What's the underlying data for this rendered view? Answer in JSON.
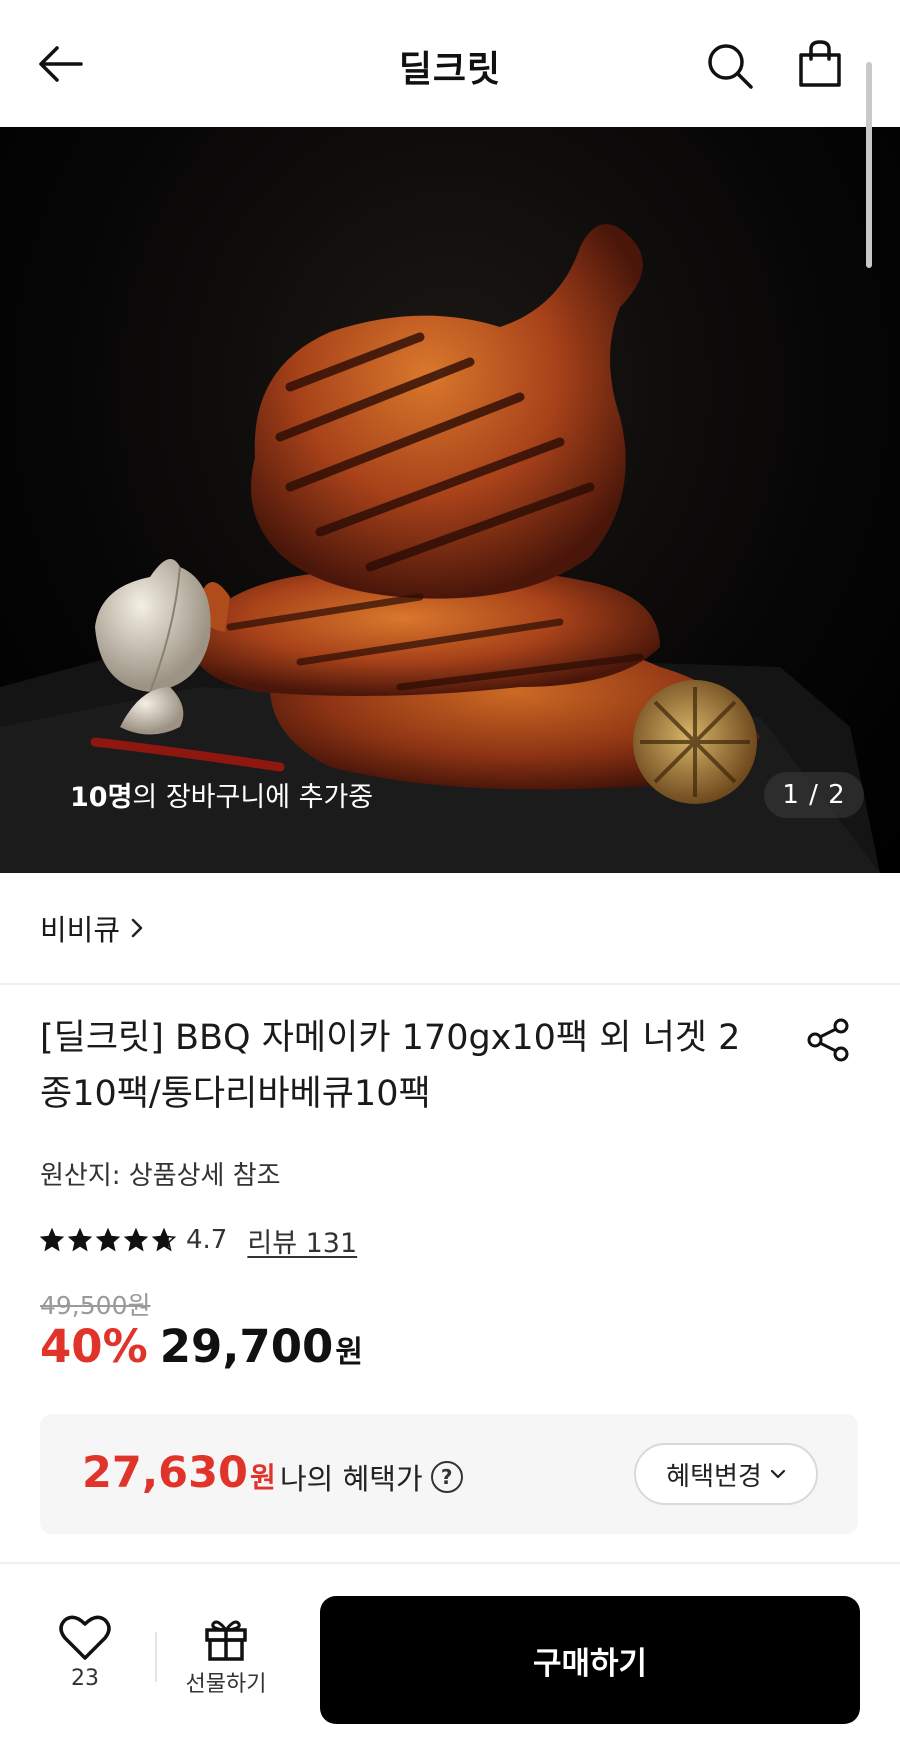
{
  "header": {
    "title": "딜크릿",
    "back_icon": "arrow-left-icon",
    "search_icon": "search-icon",
    "cart_icon": "shopping-bag-icon"
  },
  "hero": {
    "cart_count_bold": "10명",
    "cart_count_rest": "의 장바구니에 추가중",
    "page_indicator": "1 / 2"
  },
  "brand": {
    "name": "비비큐",
    "chevron": "›"
  },
  "product": {
    "title": "[딜크릿] BBQ 자메이카 170gx10팩 외 너겟 2종10팩/통다리바베큐10팩",
    "origin": "원산지: 상품상세 참조",
    "rating": "4.7",
    "rating_stars": 4.7,
    "review_link": "리뷰 131",
    "original_price": "49,500원",
    "discount": "40%",
    "price": "29,700",
    "currency": "원"
  },
  "benefit": {
    "amount": "27,630",
    "currency": "원",
    "label": "나의 혜택가",
    "help": "?",
    "change_button": "혜택변경"
  },
  "bottom_bar": {
    "like_count": "23",
    "gift_label": "선물하기",
    "buy_label": "구매하기"
  },
  "colors": {
    "accent_red": "#e0342a",
    "buy_button": "#000000"
  }
}
